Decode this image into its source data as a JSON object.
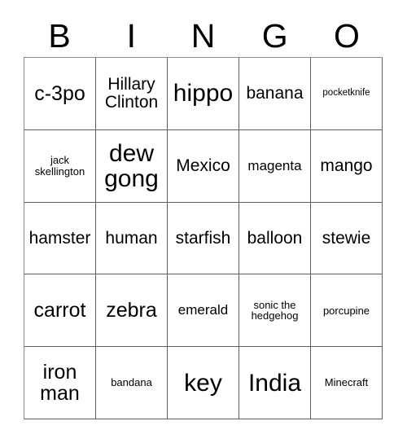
{
  "card": {
    "title_letters": [
      "B",
      "I",
      "N",
      "G",
      "O"
    ],
    "columns": 5,
    "rows": 5,
    "colors": {
      "text": "#000000",
      "background": "#ffffff",
      "grid_line": "#5e5e5e"
    },
    "cells": [
      {
        "text": "c-3po",
        "size": "lg"
      },
      {
        "text": "Hillary Clinton",
        "size": "md"
      },
      {
        "text": "hippo",
        "size": "xl"
      },
      {
        "text": "banana",
        "size": "md"
      },
      {
        "text": "pocketknife",
        "size": "xxs"
      },
      {
        "text": "jack skellington",
        "size": "xs"
      },
      {
        "text": "dew gong",
        "size": "xl"
      },
      {
        "text": "Mexico",
        "size": "md"
      },
      {
        "text": "magenta",
        "size": "sm"
      },
      {
        "text": "mango",
        "size": "md"
      },
      {
        "text": "hamster",
        "size": "md"
      },
      {
        "text": "human",
        "size": "md"
      },
      {
        "text": "starfish",
        "size": "md"
      },
      {
        "text": "balloon",
        "size": "md"
      },
      {
        "text": "stewie",
        "size": "md"
      },
      {
        "text": "carrot",
        "size": "lg"
      },
      {
        "text": "zebra",
        "size": "lg"
      },
      {
        "text": "emerald",
        "size": "sm"
      },
      {
        "text": "sonic the hedgehog",
        "size": "xs"
      },
      {
        "text": "porcupine",
        "size": "xs"
      },
      {
        "text": "iron man",
        "size": "lg"
      },
      {
        "text": "bandana",
        "size": "xs"
      },
      {
        "text": "key",
        "size": "xl"
      },
      {
        "text": "India",
        "size": "xl"
      },
      {
        "text": "Minecraft",
        "size": "xs"
      }
    ]
  }
}
